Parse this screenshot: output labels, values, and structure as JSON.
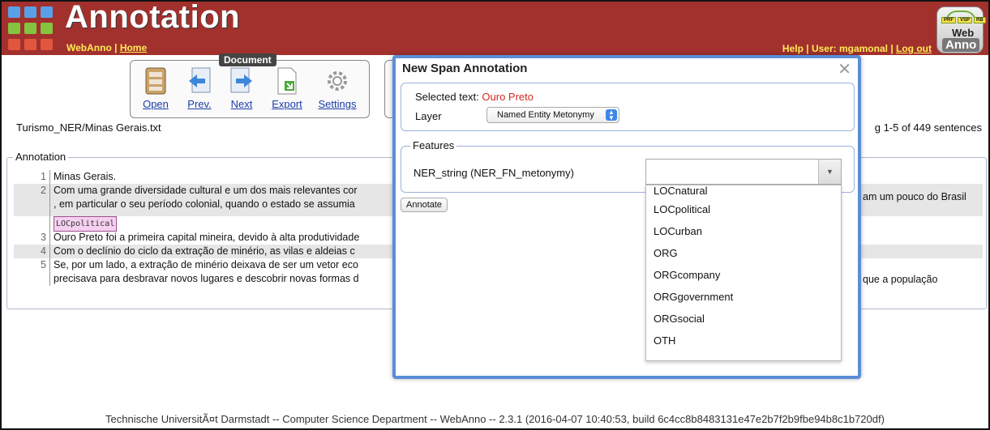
{
  "header": {
    "title": "Annotation",
    "nav_left": [
      "WebAnno",
      "Home"
    ],
    "help": "Help",
    "user_label": "User: mgamonal",
    "logout": "Log out",
    "logo_badges": [
      "PRF",
      "VSP",
      "RB"
    ],
    "logo_word1": "Web",
    "logo_word2": "Anno",
    "brand_color": "#a2312e"
  },
  "toolbar": {
    "legend": "Document",
    "buttons": [
      {
        "label": "Open",
        "icon": "open-document-icon"
      },
      {
        "label": "Prev.",
        "icon": "previous-document-icon"
      },
      {
        "label": "Next",
        "icon": "next-document-icon"
      },
      {
        "label": "Export",
        "icon": "export-icon"
      },
      {
        "label": "Settings",
        "icon": "gear-icon"
      }
    ]
  },
  "document": {
    "name": "Turismo_NER/Minas Gerais.txt",
    "sentence_info": "g 1-5 of 449 sentences"
  },
  "annotation": {
    "legend": "Annotation",
    "sentences": [
      {
        "num": "1",
        "lines": [
          "Minas Gerais."
        ]
      },
      {
        "num": "2",
        "lines": [
          "Com uma grande diversidade cultural e um dos mais relevantes cor",
          ", em particular o seu período colonial, quando o estado se assumia"
        ],
        "tail": "am um pouco do Brasil"
      },
      {
        "num": "3",
        "label": "LOCpolitical",
        "lines": [
          "Ouro Preto foi a primeira capital mineira, devido à alta produtividade"
        ]
      },
      {
        "num": "4",
        "lines": [
          "Com o declínio do ciclo da extração de minério, as vilas e aldeias c"
        ]
      },
      {
        "num": "5",
        "lines": [
          "Se, por um lado, a extração de minério deixava de ser um vetor eco",
          "precisava para desbravar novos lugares e descobrir novas formas d"
        ],
        "tail": "que a população"
      }
    ]
  },
  "modal": {
    "title": "New Span Annotation",
    "close": "✕",
    "selected_label": "Selected text:",
    "selected_value": "Ouro Preto",
    "layer_label": "Layer",
    "layer_value": "Named Entity Metonymy",
    "features_legend": "Features",
    "feature_label": "NER_string (NER_FN_metonymy)",
    "feature_value": "",
    "annotate_button": "Annotate",
    "options": [
      "LOCnatural",
      "LOCpolitical",
      "LOCurban",
      "ORG",
      "ORGcompany",
      "ORGgovernment",
      "ORGsocial",
      "OTH"
    ]
  },
  "footer": "Technische UniversitÃ¤t Darmstadt -- Computer Science Department -- WebAnno -- 2.3.1 (2016-04-07 10:40:53, build 6c4cc8b8483131e47e2b7f2b9fbe94b8c1b720df)"
}
